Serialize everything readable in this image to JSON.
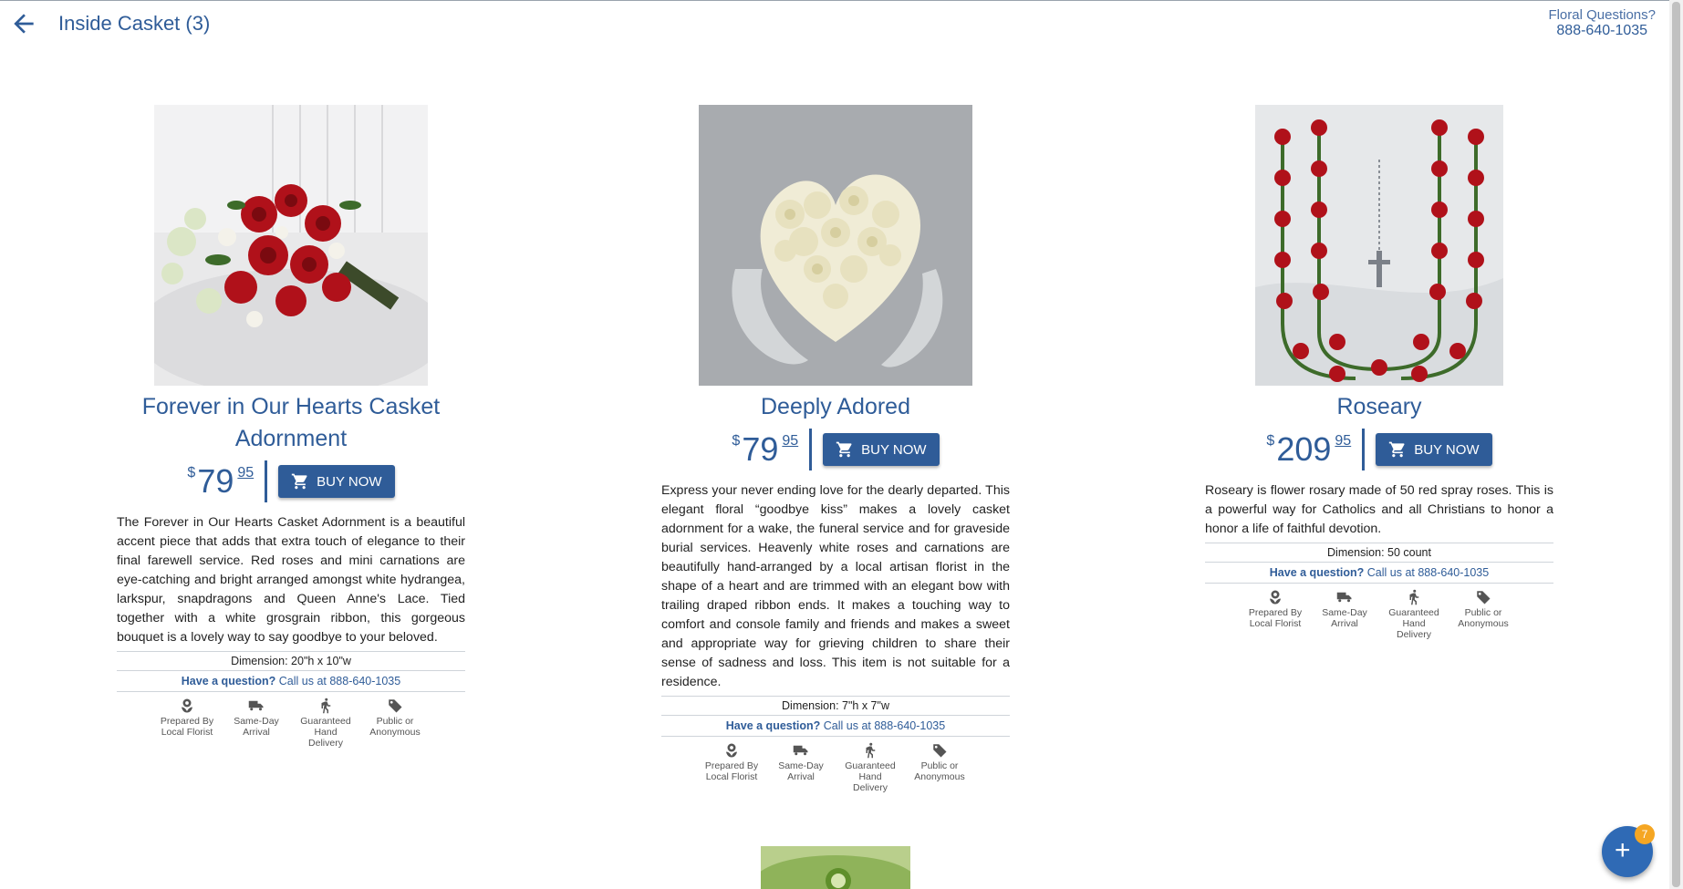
{
  "header": {
    "title": "Inside Casket (3)",
    "floral_question": "Floral Questions?",
    "phone": "888-640-1035"
  },
  "products": [
    {
      "name": "Forever in Our Hearts Casket Adornment",
      "currency": "$",
      "price_dollars": "79",
      "price_cents": "95",
      "buy_label": "BUY NOW",
      "description": "The Forever in Our Hearts Casket Adornment is a beautiful accent piece that adds that extra touch of elegance to their final farewell service. Red roses and mini carnations are eye-catching and bright arranged amongst white hydrangea, larkspur, snapdragons and Queen Anne's Lace. Tied together with a white grosgrain ribbon, this gorgeous bouquet is a lovely way to say goodbye to your beloved.",
      "dimension": "Dimension: 20\"h x 10\"w",
      "question_label": "Have a question?",
      "question_text": "Call us at 888-640-1035"
    },
    {
      "name": "Deeply Adored",
      "currency": "$",
      "price_dollars": "79",
      "price_cents": "95",
      "buy_label": "BUY NOW",
      "description": "Express your never ending love for the dearly departed. This elegant floral “goodbye kiss” makes a lovely casket adornment for a wake, the funeral service and for graveside burial services. Heavenly white roses and carnations are beautifully hand-arranged by a local artisan florist in the shape of a heart and are trimmed with an elegant bow with trailing draped ribbon ends. It makes a touching way to comfort and console family and friends and makes a sweet and appropriate way for grieving children to share their sense of sadness and loss. This item is not suitable for a residence.",
      "dimension": "Dimension: 7\"h x 7\"w",
      "question_label": "Have a question?",
      "question_text": "Call us at 888-640-1035"
    },
    {
      "name": "Roseary",
      "currency": "$",
      "price_dollars": "209",
      "price_cents": "95",
      "buy_label": "BUY NOW",
      "description": "Roseary is flower rosary made of 50 red spray roses. This is a powerful way for Catholics and all Christians to honor a honor a life of faithful devotion.",
      "dimension": "Dimension: 50 count",
      "question_label": "Have a question?",
      "question_text": "Call us at 888-640-1035"
    }
  ],
  "features": {
    "local_florist_1": "Prepared By",
    "local_florist_2": "Local Florist",
    "same_day_1": "Same-Day",
    "same_day_2": "Arrival",
    "hand_delivery_1": "Guaranteed",
    "hand_delivery_2": "Hand Delivery",
    "public_1": "Public or",
    "public_2": "Anonymous"
  },
  "cart": {
    "fab_icon": "plus-icon",
    "badge_count": "7"
  },
  "colors": {
    "brand_blue": "#2f5c98",
    "badge_orange": "#f5a623"
  }
}
